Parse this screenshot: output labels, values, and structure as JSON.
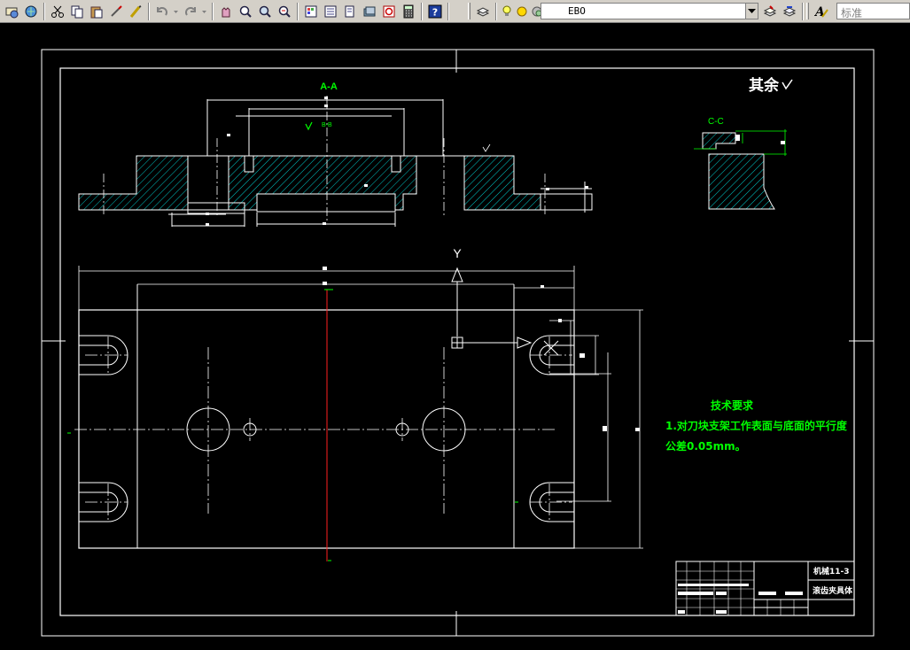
{
  "toolbar": {
    "layer_name": "EBO",
    "text_style": "标准",
    "icons": [
      "plot-preview-icon",
      "publish-icon",
      "cut-icon",
      "copy-icon",
      "paste-icon",
      "match-properties-icon",
      "brush-icon",
      "undo-icon",
      "redo-icon",
      "pan-icon",
      "zoom-realtime-icon",
      "zoom-window-icon",
      "zoom-previous-icon",
      "properties-icon",
      "design-center-icon",
      "tool-palette-icon",
      "sheet-set-icon",
      "markup-icon",
      "calculator-icon",
      "help-icon",
      "layer-manager-icon",
      "layer-on-icon",
      "layer-freeze-icon",
      "layer-lock-icon",
      "layer-color-icon",
      "make-current-icon",
      "layer-previous-icon",
      "text-style-icon"
    ]
  },
  "drawing": {
    "section_aa": "A-A",
    "section_cc": "C-C",
    "surface_note": "其余",
    "axis_label": "Y",
    "tech_title": "技术要求",
    "tech_line1": "1.对刀块支架工作表面与底面的平行度",
    "tech_line2": "公差0.05mm。",
    "small_marker": "B-B",
    "title_block": {
      "drawing_no": "机械11-3",
      "part_name": "滚齿夹具体"
    }
  },
  "colors": {
    "background": "#000000",
    "lines": "#ffffff",
    "text": "#00ff00",
    "hatch": "#00c8c8",
    "centerline": "#ff2020"
  }
}
